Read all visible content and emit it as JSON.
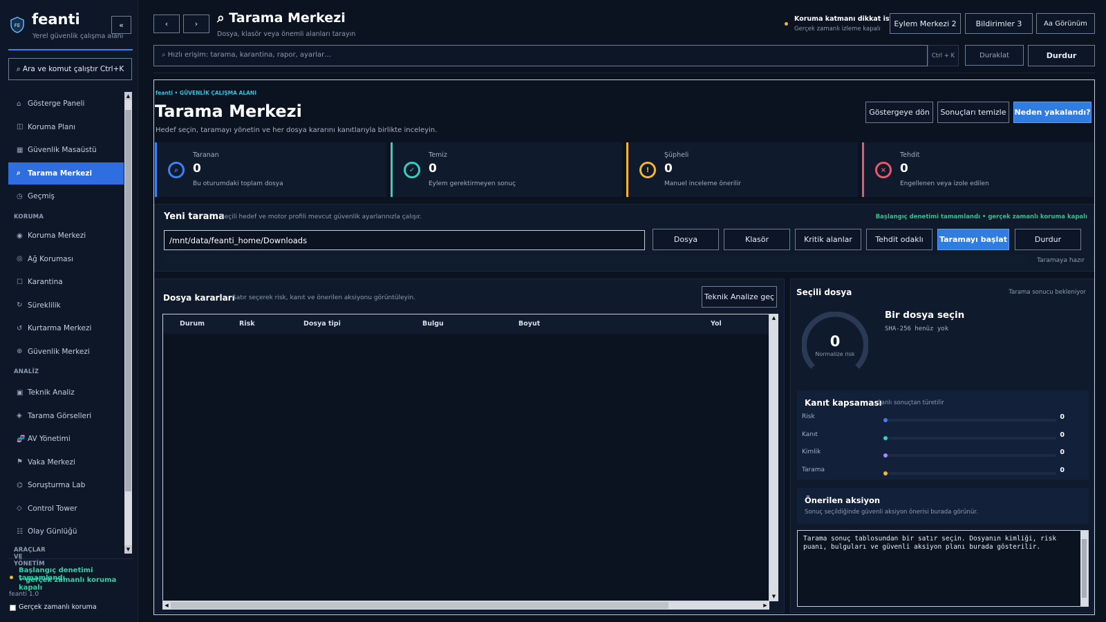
{
  "app": {
    "name": "feanti",
    "subtitle": "Yerel güvenlik çalışma alanı",
    "logo_text": "FE",
    "collapse_glyph": "«"
  },
  "sidebar": {
    "search_label": "⌕ Ara ve komut çalıştır  Ctrl+K",
    "items": [
      {
        "icon": "⌂",
        "label": "Gösterge Paneli"
      },
      {
        "icon": "◫",
        "label": "Koruma Planı"
      },
      {
        "icon": "▦",
        "label": "Güvenlik Masaüstü"
      },
      {
        "icon": "⌕",
        "label": "Tarama Merkezi",
        "active": true
      },
      {
        "icon": "◷",
        "label": "Geçmiş"
      }
    ],
    "section_protection": "KORUMA",
    "protection_items": [
      {
        "icon": "◉",
        "label": "Koruma Merkezi"
      },
      {
        "icon": "◎",
        "label": "Ağ Koruması"
      },
      {
        "icon": "☐",
        "label": "Karantina"
      },
      {
        "icon": "↻",
        "label": "Süreklilik"
      },
      {
        "icon": "↺",
        "label": "Kurtarma Merkezi"
      },
      {
        "icon": "⊕",
        "label": "Güvenlik Merkezi"
      }
    ],
    "section_analysis": "ANALİZ",
    "analysis_items": [
      {
        "icon": "▣",
        "label": "Teknik Analiz"
      },
      {
        "icon": "◈",
        "label": "Tarama Görselleri"
      },
      {
        "icon": "🧬",
        "label": "AV Yönetimi"
      },
      {
        "icon": "⚑",
        "label": "Vaka Merkezi"
      },
      {
        "icon": "⌬",
        "label": "Soruşturma Lab"
      },
      {
        "icon": "◇",
        "label": "Control Tower"
      },
      {
        "icon": "☷",
        "label": "Olay Günlüğü"
      }
    ],
    "section_tools": "ARAÇLAR VE YÖNETİM",
    "status_line1": "Başlangıç denetimi tamamlandı",
    "status_line2": "• gerçek zamanlı koruma kapalı",
    "version": "feanti 1.0",
    "realtime_checkbox": "Gerçek zamanlı koruma"
  },
  "header": {
    "back": "‹",
    "forward": "›",
    "title": "⌕ Tarama Merkezi",
    "subtitle": "Dosya, klasör veya önemli alanları tarayın",
    "alert_title": "Koruma katmanı dikkat istiyor",
    "alert_sub": "Gerçek zamanlı izleme kapalı",
    "action_center": "Eylem Merkezi  2",
    "notifications": "Bildirimler 3",
    "view": "Aa Görünüm",
    "quick_search_placeholder": "⌕ Hızlı erişim: tarama, karantina, rapor, ayarlar…",
    "shortcut": "Ctrl + K",
    "pause": "Duraklat",
    "stop": "Durdur"
  },
  "workspace": {
    "breadcrumb": "feanti • GÜVENLİK ÇALIŞMA ALANI",
    "title": "Tarama Merkezi",
    "description": "Hedef seçin, taramayı yönetin ve her dosya kararını kanıtlarıyla birlikte inceleyin.",
    "back_dashboard": "Göstergeye dön",
    "clear_results": "Sonuçları temizle",
    "why_caught": "Neden yakalandı?"
  },
  "stats": [
    {
      "label": "Taranan",
      "value": "0",
      "sub": "Bu oturumdaki toplam dosya",
      "glyph": "⌕",
      "color": "#3b82f6"
    },
    {
      "label": "Temiz",
      "value": "0",
      "sub": "Eylem gerektirmeyen sonuç",
      "glyph": "✓",
      "color": "#2dd4bf"
    },
    {
      "label": "Şüpheli",
      "value": "0",
      "sub": "Manuel inceleme önerilir",
      "glyph": "!",
      "color": "#f5b731"
    },
    {
      "label": "Tehdit",
      "value": "0",
      "sub": "Engellenen veya izole edilen",
      "glyph": "×",
      "color": "#f0566a"
    }
  ],
  "new_scan": {
    "title": "Yeni tarama",
    "hint": "Seçili hedef ve motor profili mevcut güvenlik ayarlarınızla çalışır.",
    "status_right": "Başlangıç denetimi tamamlandı • gerçek zamanlı koruma kapalı",
    "path_value": "/mnt/data/feanti_home/Downloads",
    "btn_file": "Dosya",
    "btn_folder": "Klasör",
    "btn_critical": "Kritik alanlar",
    "btn_threat": "Tehdit odaklı",
    "btn_start": "Taramayı başlat",
    "btn_stop": "Durdur",
    "ready": "Taramaya hazır"
  },
  "decisions": {
    "title": "Dosya kararları",
    "hint": "Satır seçerek risk, kanıt ve önerilen aksiyonu görüntüleyin.",
    "tech_btn": "Teknik Analize geç",
    "columns": [
      "Durum",
      "Risk",
      "Dosya tipi",
      "Bulgu",
      "Boyut",
      "Yol"
    ]
  },
  "selected": {
    "title": "Seçili dosya",
    "waiting": "Tarama sonucu bekleniyor",
    "gauge_value": "0",
    "gauge_label": "Normalize risk",
    "file_title": "Bir dosya seçin",
    "sha": "SHA-256 henüz yok",
    "coverage_title": "Kanıt kapsaması",
    "coverage_hint": "Canlı sonuçtan türetilir",
    "coverage": [
      {
        "name": "Risk",
        "value": "0",
        "color": "#3b82f6"
      },
      {
        "name": "Kanıt",
        "value": "0",
        "color": "#2dd4bf"
      },
      {
        "name": "Kimlik",
        "value": "0",
        "color": "#a78bfa"
      },
      {
        "name": "Tarama",
        "value": "0",
        "color": "#f5b731"
      }
    ],
    "action_title": "Önerilen aksiyon",
    "action_hint": "Sonuç seçildiğinde güvenli aksiyon önerisi burada görünür.",
    "details_text": "Tarama sonuç tablosundan bir satır seçin. Dosyanın kimliği, risk puanı, bulguları ve güvenli aksiyon planı burada gösterilir."
  }
}
